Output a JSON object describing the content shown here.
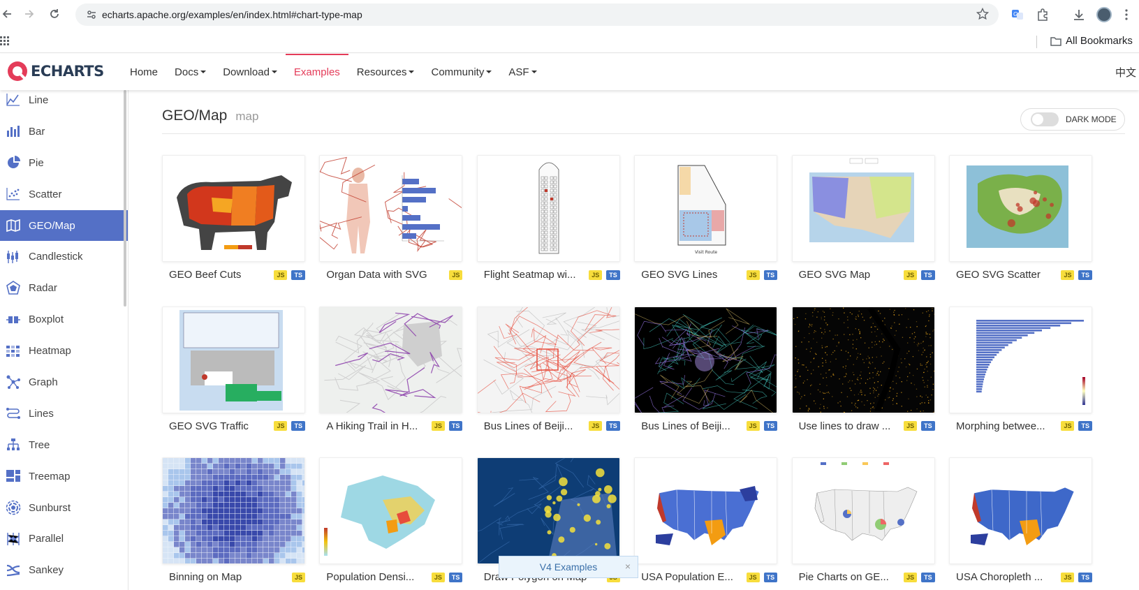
{
  "browser": {
    "url": "echarts.apache.org/examples/en/index.html#chart-type-map",
    "bookmarks_label": "All Bookmarks"
  },
  "nav": {
    "logo_text": "ECHARTS",
    "items": [
      {
        "label": "Home",
        "dropdown": false,
        "active": false
      },
      {
        "label": "Docs",
        "dropdown": true,
        "active": false
      },
      {
        "label": "Download",
        "dropdown": true,
        "active": false
      },
      {
        "label": "Examples",
        "dropdown": false,
        "active": true
      },
      {
        "label": "Resources",
        "dropdown": true,
        "active": false
      },
      {
        "label": "Community",
        "dropdown": true,
        "active": false
      },
      {
        "label": "ASF",
        "dropdown": true,
        "active": false
      }
    ],
    "language": "中文",
    "accent_color": "#e43c59"
  },
  "sidebar": {
    "active_color": "#5470c6",
    "items": [
      {
        "label": "Line",
        "icon": "line-chart-icon",
        "active": false
      },
      {
        "label": "Bar",
        "icon": "bar-chart-icon",
        "active": false
      },
      {
        "label": "Pie",
        "icon": "pie-chart-icon",
        "active": false
      },
      {
        "label": "Scatter",
        "icon": "scatter-chart-icon",
        "active": false
      },
      {
        "label": "GEO/Map",
        "icon": "map-icon",
        "active": true
      },
      {
        "label": "Candlestick",
        "icon": "candlestick-icon",
        "active": false
      },
      {
        "label": "Radar",
        "icon": "radar-icon",
        "active": false
      },
      {
        "label": "Boxplot",
        "icon": "boxplot-icon",
        "active": false
      },
      {
        "label": "Heatmap",
        "icon": "heatmap-icon",
        "active": false
      },
      {
        "label": "Graph",
        "icon": "graph-icon",
        "active": false
      },
      {
        "label": "Lines",
        "icon": "lines-icon",
        "active": false
      },
      {
        "label": "Tree",
        "icon": "tree-icon",
        "active": false
      },
      {
        "label": "Treemap",
        "icon": "treemap-icon",
        "active": false
      },
      {
        "label": "Sunburst",
        "icon": "sunburst-icon",
        "active": false
      },
      {
        "label": "Parallel",
        "icon": "parallel-icon",
        "active": false
      },
      {
        "label": "Sankey",
        "icon": "sankey-icon",
        "active": false
      }
    ]
  },
  "page": {
    "title": "GEO/Map",
    "subtitle": "map",
    "dark_mode_label": "DARK MODE"
  },
  "examples": [
    {
      "title": "GEO Beef Cuts",
      "js": true,
      "ts": true,
      "thumb": "beef"
    },
    {
      "title": "Organ Data with SVG",
      "js": true,
      "ts": false,
      "thumb": "organ"
    },
    {
      "title": "Flight Seatmap wi...",
      "js": true,
      "ts": true,
      "thumb": "seat"
    },
    {
      "title": "GEO SVG Lines",
      "js": true,
      "ts": true,
      "thumb": "floor"
    },
    {
      "title": "GEO SVG Map",
      "js": true,
      "ts": true,
      "thumb": "sicily"
    },
    {
      "title": "GEO SVG Scatter",
      "js": true,
      "ts": true,
      "thumb": "iceland"
    },
    {
      "title": "GEO SVG Traffic",
      "js": true,
      "ts": true,
      "thumb": "traffic"
    },
    {
      "title": "A Hiking Trail in H...",
      "js": true,
      "ts": true,
      "thumb": "hiking"
    },
    {
      "title": "Bus Lines of Beiji...",
      "js": true,
      "ts": true,
      "thumb": "busred"
    },
    {
      "title": "Bus Lines of Beiji...",
      "js": true,
      "ts": true,
      "thumb": "busdark"
    },
    {
      "title": "Use lines to draw ...",
      "js": true,
      "ts": true,
      "thumb": "nyc"
    },
    {
      "title": "Morphing betwee...",
      "js": true,
      "ts": true,
      "thumb": "morph"
    },
    {
      "title": "Binning on Map",
      "js": true,
      "ts": false,
      "thumb": "binning"
    },
    {
      "title": "Population Densi...",
      "js": true,
      "ts": true,
      "thumb": "hk"
    },
    {
      "title": "Draw Polygon on Map",
      "js": true,
      "ts": false,
      "thumb": "polygon"
    },
    {
      "title": "USA Population E...",
      "js": true,
      "ts": true,
      "thumb": "usa"
    },
    {
      "title": "Pie Charts on GE...",
      "js": true,
      "ts": true,
      "thumb": "usapie"
    },
    {
      "title": "USA Choropleth ...",
      "js": true,
      "ts": true,
      "thumb": "usa2"
    }
  ],
  "badges": {
    "js": "JS",
    "ts": "TS"
  },
  "v4_banner": {
    "label": "V4 Examples",
    "close": "×"
  }
}
